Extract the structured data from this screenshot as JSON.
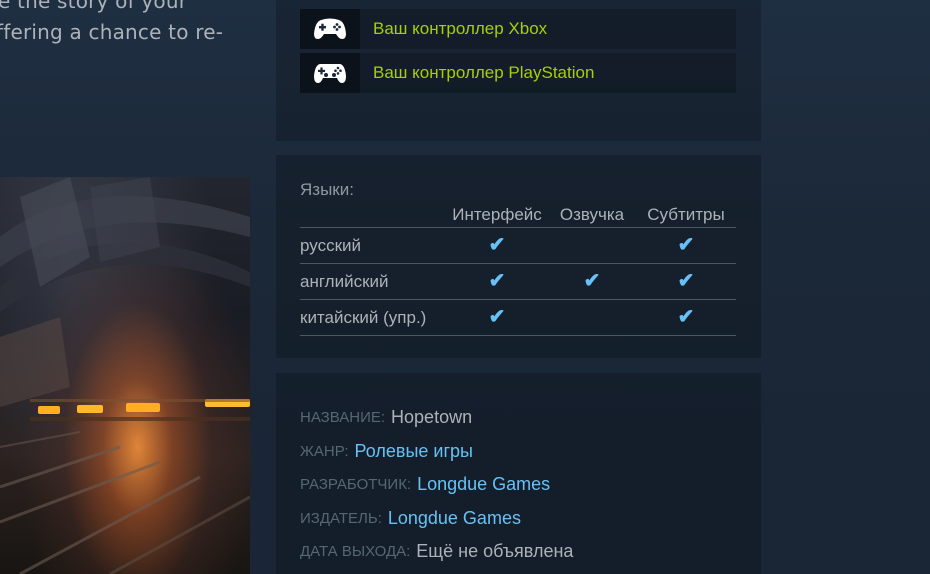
{
  "description": {
    "line1": "e the story of your",
    "line2": "ffering a chance to re-"
  },
  "controllers": [
    {
      "icon": "xbox-controller-icon",
      "label": "Ваш контроллер Xbox"
    },
    {
      "icon": "playstation-controller-icon",
      "label": "Ваш контроллер PlayStation"
    }
  ],
  "languages": {
    "title": "Языки:",
    "columns": [
      "Интерфейс",
      "Озвучка",
      "Субтитры"
    ],
    "check_mark": "✔",
    "rows": [
      {
        "name": "русский",
        "interface": "✔",
        "audio": "",
        "subtitles": "✔"
      },
      {
        "name": "английский",
        "interface": "✔",
        "audio": "✔",
        "subtitles": "✔"
      },
      {
        "name": "китайский (упр.)",
        "interface": "✔",
        "audio": "",
        "subtitles": "✔"
      }
    ]
  },
  "details": {
    "title": {
      "key": "НАЗВАНИЕ:",
      "value": "Hopetown"
    },
    "genre": {
      "key": "ЖАНР:",
      "value": "Ролевые игры"
    },
    "developer": {
      "key": "РАЗРАБОТЧИК:",
      "value": "Longdue Games"
    },
    "publisher": {
      "key": "ИЗДАТЕЛЬ:",
      "value": "Longdue Games"
    },
    "release": {
      "key": "ДАТА ВЫХОДА:",
      "value": "Ещё не объявлена"
    }
  },
  "colors": {
    "background": "#1b2838",
    "controller_label": "#a4d007",
    "link": "#67c1f5",
    "muted": "#556772",
    "text": "#acb2b8"
  }
}
